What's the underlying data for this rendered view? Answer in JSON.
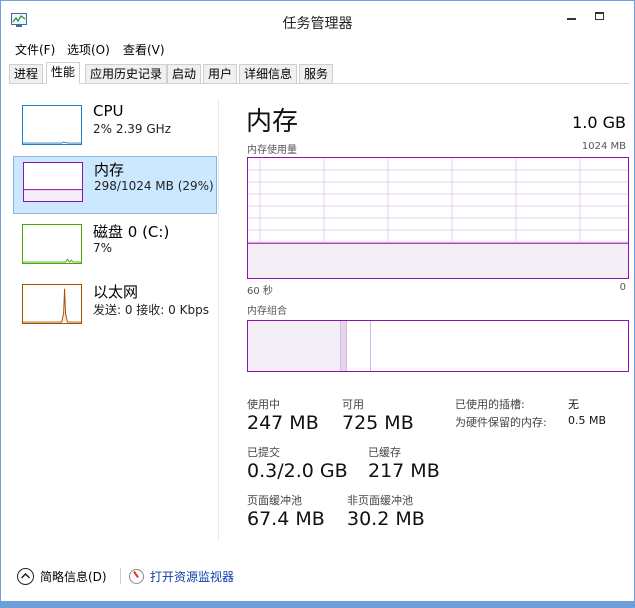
{
  "window": {
    "title": "任务管理器"
  },
  "menu": [
    "文件(F)",
    "选项(O)",
    "查看(V)"
  ],
  "tabs": [
    "进程",
    "性能",
    "应用历史记录",
    "启动",
    "用户",
    "详细信息",
    "服务"
  ],
  "active_tab": "性能",
  "resources": [
    {
      "name": "CPU",
      "sub": "2% 2.39 GHz",
      "color": "#1e7ec8"
    },
    {
      "name": "内存",
      "sub": "298/1024 MB (29%)",
      "color": "#8b12ae",
      "selected": true
    },
    {
      "name": "磁盘 0 (C:)",
      "sub": "7%",
      "color": "#4da60c"
    },
    {
      "name": "以太网",
      "sub": "发送: 0 接收: 0 Kbps",
      "color": "#a74f01"
    }
  ],
  "detail": {
    "heading": "内存",
    "total": "1.0 GB",
    "usage_graph": {
      "label": "内存使用量",
      "max_label": "1024 MB",
      "time_label": "60 秒",
      "end_label": "0",
      "usage_fraction": 0.29
    },
    "composition": {
      "label": "内存组合",
      "in_use_mb": 247,
      "modified_mb": 20,
      "standby_mb": 64,
      "free_mb": 693
    },
    "stats": {
      "in_use": {
        "label": "使用中",
        "value": "247 MB"
      },
      "available": {
        "label": "可用",
        "value": "725 MB"
      },
      "committed": {
        "label": "已提交",
        "value": "0.3/2.0 GB"
      },
      "cached": {
        "label": "已缓存",
        "value": "217 MB"
      },
      "paged_pool": {
        "label": "页面缓冲池",
        "value": "67.4 MB"
      },
      "nonpaged_pool": {
        "label": "非页面缓冲池",
        "value": "30.2 MB"
      },
      "slots_used": {
        "label": "已使用的插槽:",
        "value": "无"
      },
      "hw_reserved": {
        "label": "为硬件保留的内存:",
        "value": "0.5 MB"
      }
    }
  },
  "footer": {
    "fewer_details": "简略信息(D)",
    "resource_monitor": "打开资源监视器"
  },
  "colors": {
    "memory": "#8b12ae",
    "memory_fill": "#f3edf5",
    "link": "#0a3fa8",
    "selected_bg": "#cce8ff"
  }
}
